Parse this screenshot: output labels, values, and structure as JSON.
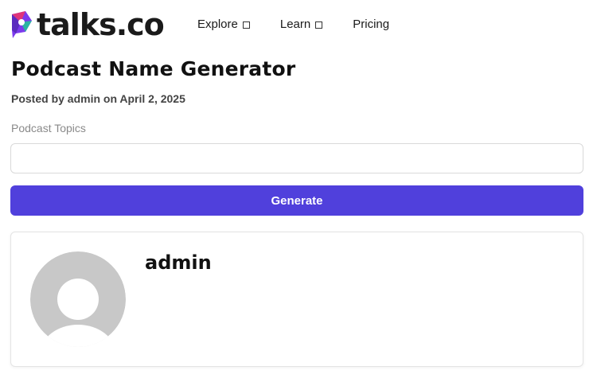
{
  "brand": {
    "name": "talks.co",
    "logo_colors": [
      "#e0357a",
      "#7c3aed",
      "#2bb3a3"
    ]
  },
  "nav": {
    "items": [
      {
        "label": "Explore",
        "has_dropdown": true
      },
      {
        "label": "Learn",
        "has_dropdown": true
      },
      {
        "label": "Pricing",
        "has_dropdown": false
      }
    ]
  },
  "article": {
    "title": "Podcast Name Generator",
    "meta": "Posted by admin on April 2, 2025"
  },
  "form": {
    "topics_label": "Podcast Topics",
    "topics_value": "",
    "topics_placeholder": "",
    "generate_label": "Generate",
    "button_color": "#5040dc"
  },
  "author": {
    "name": "admin",
    "avatar_icon": "default-user-icon"
  }
}
